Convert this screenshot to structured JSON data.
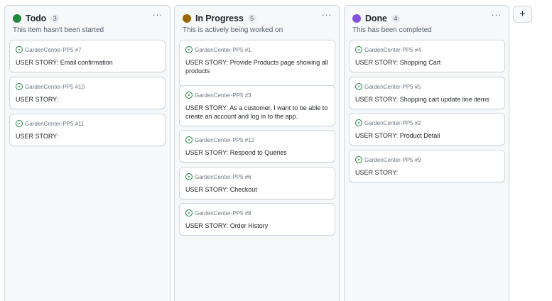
{
  "columns": [
    {
      "title": "Todo",
      "count": "3",
      "description": "This item hasn't been started",
      "color": "#1f883d",
      "more_icon": "ellipsis-icon",
      "cards": [
        {
          "repo": "GardenCenter-PP5 #7",
          "title": "USER STORY: Email confirmation"
        },
        {
          "repo": "GardenCenter-PP5 #10",
          "title": "USER STORY:"
        },
        {
          "repo": "GardenCenter-PP5 #11",
          "title": "USER STORY:"
        }
      ]
    },
    {
      "title": "In Progress",
      "count": "5",
      "description": "This is actively being worked on",
      "color": "#9a6700",
      "more_icon": "ellipsis-icon",
      "cards": [
        {
          "repo": "GardenCenter-PP5 #1",
          "title": "USER STORY: Provide Products page showing all products"
        },
        {
          "repo": "GardenCenter-PP5 #3",
          "title": "USER STORY: As a customer, I want to be able to create an account and log in to the app."
        },
        {
          "repo": "GardenCenter-PP5 #12",
          "title": "USER STORY: Respond to Queries"
        },
        {
          "repo": "GardenCenter-PP5 #6",
          "title": "USER STORY: Checkout"
        },
        {
          "repo": "GardenCenter-PP5 #8",
          "title": "USER STORY: Order History"
        }
      ]
    },
    {
      "title": "Done",
      "count": "4",
      "description": "This has been completed",
      "color": "#8250df",
      "more_icon": "ellipsis-icon",
      "cards": [
        {
          "repo": "GardenCenter-PP5 #4",
          "title": "USER STORY: Shopping Cart"
        },
        {
          "repo": "GardenCenter-PP5 #5",
          "title": "USER STORY: Shopping cart update line items"
        },
        {
          "repo": "GardenCenter-PP5 #2",
          "title": "USER STORY: Product Detail"
        },
        {
          "repo": "GardenCenter-PP5 #9",
          "title": "USER STORY:"
        }
      ]
    }
  ],
  "add_column": {
    "label": "+",
    "icon": "plus-icon"
  },
  "issue_icon": "issue-open-icon",
  "issue_icon_color": "#1a7f37"
}
